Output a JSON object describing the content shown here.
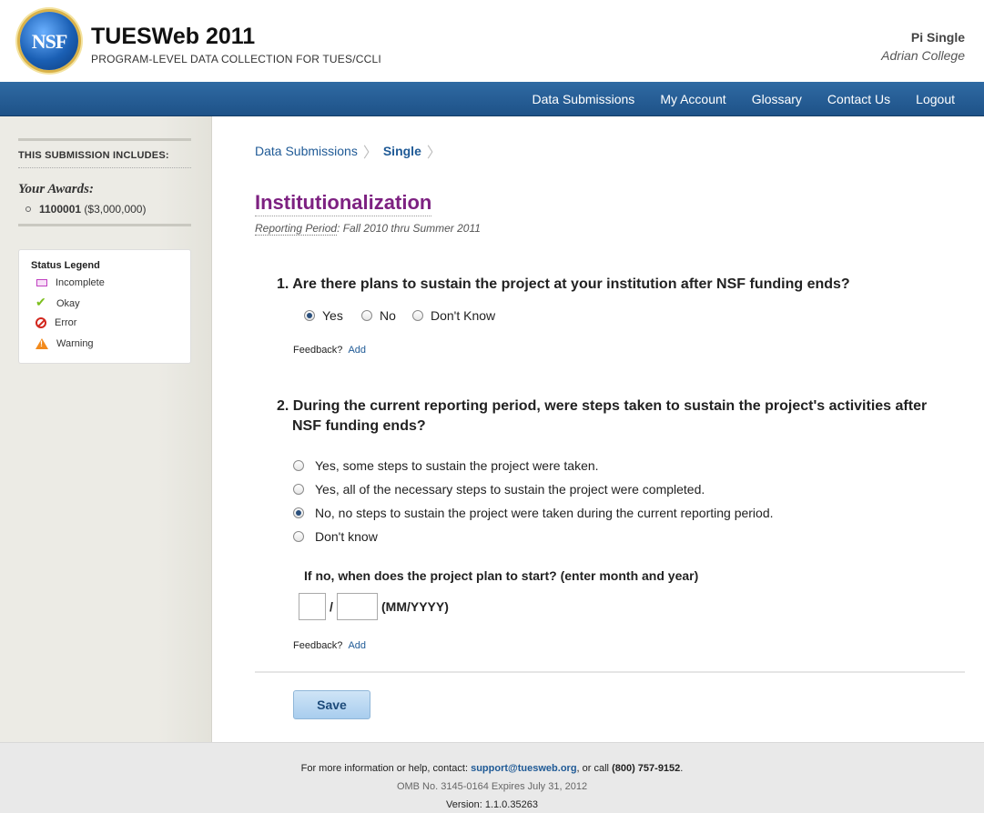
{
  "header": {
    "logo_text": "NSF",
    "title": "TUESWeb 2011",
    "subtitle": "PROGRAM-LEVEL DATA COLLECTION FOR TUES/CCLI",
    "user_name": "Pi Single",
    "user_org": "Adrian College"
  },
  "nav": {
    "items": [
      "Data Submissions",
      "My Account",
      "Glossary",
      "Contact Us",
      "Logout"
    ]
  },
  "sidebar": {
    "heading": "THIS SUBMISSION INCLUDES:",
    "awards_label": "Your Awards:",
    "award_number": "1100001",
    "award_amount": "($3,000,000)",
    "legend": {
      "title": "Status Legend",
      "items": [
        "Incomplete",
        "Okay",
        "Error",
        "Warning"
      ]
    }
  },
  "main": {
    "breadcrumb": {
      "root": "Data Submissions",
      "current": "Single"
    },
    "page_title": "Institutionalization",
    "period_label": "Reporting Period",
    "period_value": ": Fall 2010 thru Summer 2011",
    "q1": {
      "text": "1. Are there plans to sustain the project at your institution after NSF funding ends?",
      "options": [
        "Yes",
        "No",
        "Don't Know"
      ],
      "selected": "Yes"
    },
    "q2": {
      "line1": "2. During the current reporting period, were steps taken to sustain the project's activities after",
      "line2": "NSF funding ends?",
      "options": [
        "Yes, some steps to sustain the project were taken.",
        "Yes, all of the necessary steps to sustain the project were completed.",
        "No, no steps to sustain the project were taken during the current reporting period.",
        "Don't know"
      ],
      "selected_index": 2,
      "followup": "If no, when does the project plan to start? (enter month and year)",
      "month_value": "",
      "year_value": "",
      "date_slash": "/",
      "date_format": "(MM/YYYY)"
    },
    "feedback_label": "Feedback?",
    "feedback_add": "Add",
    "save_label": "Save"
  },
  "footer": {
    "line1_prefix": "For more information or help, contact: ",
    "email": "support@tuesweb.org",
    "line1_mid": ", or call ",
    "phone": "(800) 757-9152",
    "line1_end": ".",
    "omb": "OMB No. 3145-0164 Expires July 31, 2012",
    "version": "Version: 1.1.0.35263"
  }
}
